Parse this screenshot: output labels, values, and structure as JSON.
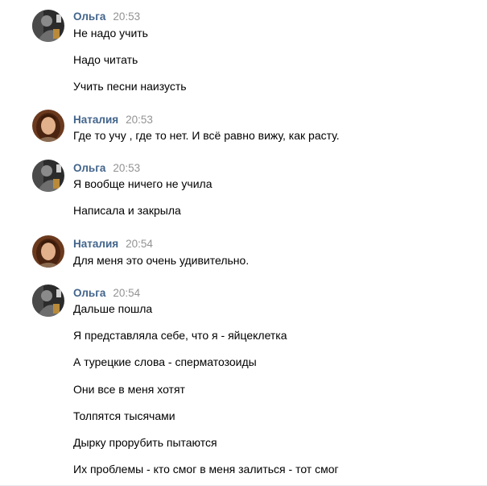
{
  "messages": [
    {
      "author": "Ольга",
      "time": "20:53",
      "lines": [
        "Не надо учить",
        "Надо читать",
        "Учить песни наизусть"
      ]
    },
    {
      "author": "Наталия",
      "time": "20:53",
      "lines": [
        "Где то учу , где то нет. И всё равно вижу, как расту."
      ]
    },
    {
      "author": "Ольга",
      "time": "20:53",
      "lines": [
        "Я вообще ничего не учила",
        "Написала и закрыла"
      ]
    },
    {
      "author": "Наталия",
      "time": "20:54",
      "lines": [
        "Для меня это очень удивительно."
      ]
    },
    {
      "author": "Ольга",
      "time": "20:54",
      "lines": [
        "Дальше пошла",
        "Я представляла себе, что я - яйцеклетка",
        "А турецкие слова - сперматозоиды",
        "Они все в меня хотят",
        "Толпятся тысячами",
        "Дырку прорубить пытаются",
        "Их проблемы - кто смог в меня залиться - тот смог"
      ]
    }
  ],
  "colors": {
    "author": "#42648b",
    "time": "#939393",
    "text": "#000000"
  }
}
